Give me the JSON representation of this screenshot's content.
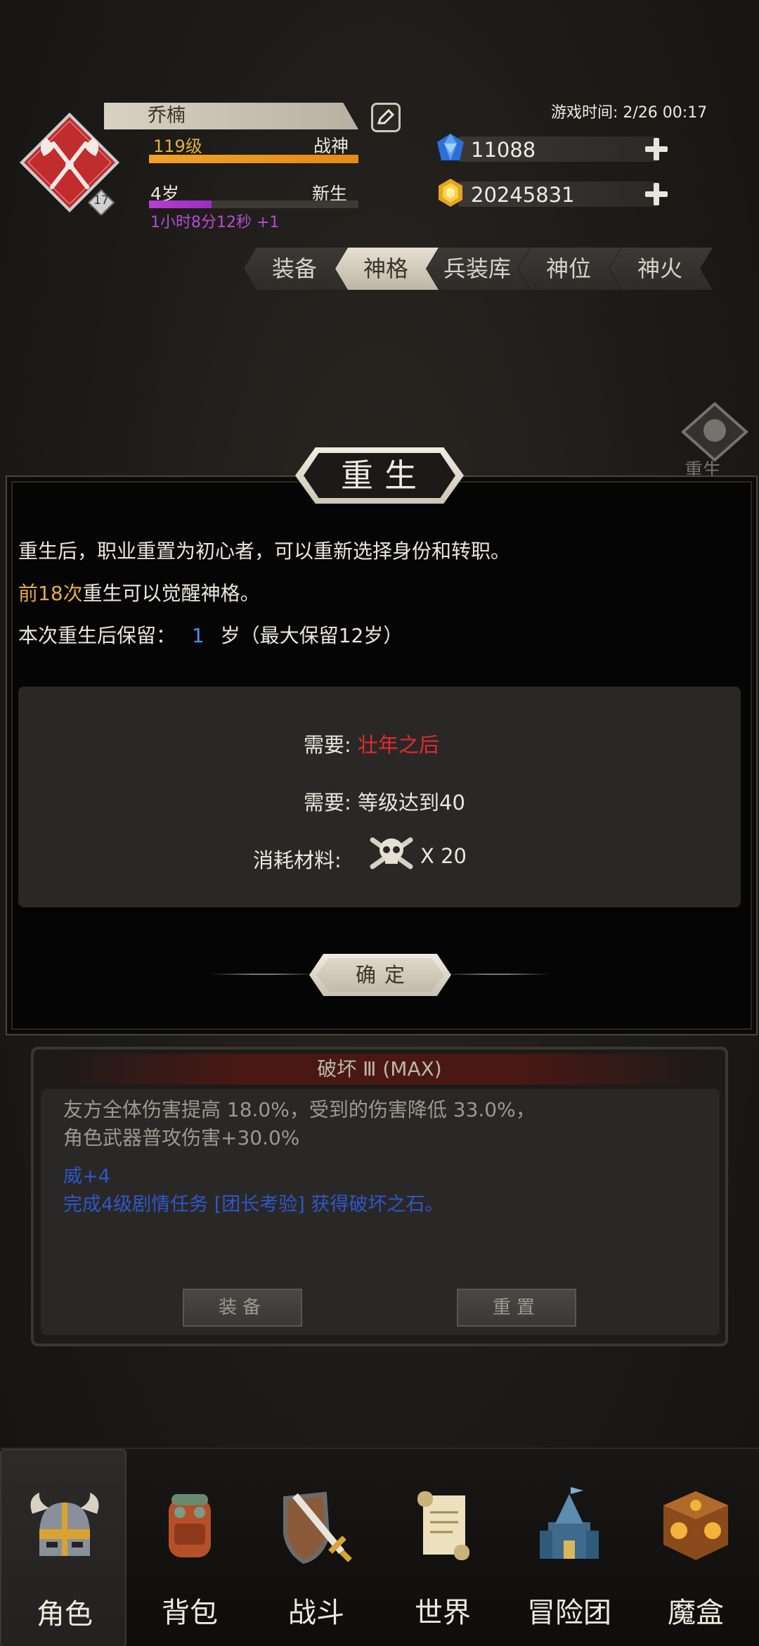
{
  "player": {
    "name": "乔楠",
    "level_text": "119级",
    "class": "战神",
    "level_progress": 1.0,
    "age_text": "4岁",
    "stage": "新生",
    "age_progress": 0.3,
    "timer": "1小时8分12秒 +1",
    "badge_level": "17"
  },
  "game_time": "游戏时间: 2/26 00:17",
  "resources": {
    "gems": "11088",
    "gold": "20245831"
  },
  "tabs": [
    "装备",
    "神格",
    "兵装库",
    "神位",
    "神火"
  ],
  "active_tab": "神格",
  "side_label": "重生",
  "dialog": {
    "title": "重生",
    "line1": "重生后，职业重置为初心者，可以重新选择身份和转职。",
    "line2_highlight": "前18次",
    "line2_rest": "重生可以觉醒神格。",
    "line3_prefix": "本次重生后保留：",
    "line3_value": "1",
    "line3_suffix": "岁（最大保留12岁）",
    "req1_label": "需要:",
    "req1_value": "壮年之后",
    "req2_label": "需要:",
    "req2_value": "等级达到40",
    "material_label": "消耗材料:",
    "material_count": "X 20",
    "confirm": "确定"
  },
  "skill": {
    "title": "破坏 Ⅲ (MAX)",
    "desc1": "友方全体伤害提高 18.0%，受到的伤害降低 33.0%，",
    "desc2": "角色武器普攻伤害+30.0%",
    "bonus": "威+4",
    "unlock": "完成4级剧情任务 [团长考验] 获得破坏之石。",
    "equip_button": "装备",
    "reset_button": "重置"
  },
  "nav": [
    "角色",
    "背包",
    "战斗",
    "世界",
    "冒险团",
    "魔盒"
  ],
  "colors": {
    "accent_orange": "#e7a94a",
    "red": "#e02d2d",
    "blue": "#4a8ee8",
    "level_bar": "#f0a226",
    "age_bar": "#b63ed2"
  }
}
